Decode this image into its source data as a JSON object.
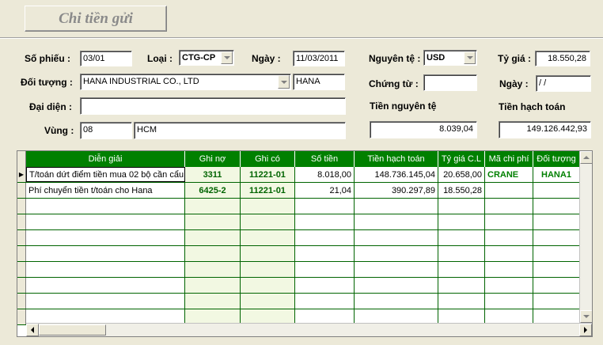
{
  "form": {
    "title": "Chi tiền gửi",
    "so_phieu_label": "Số phiếu :",
    "so_phieu_value": "03/01",
    "loai_label": "Loại :",
    "loai_value": "CTG-CP",
    "ngay_label": "Ngày :",
    "ngay_value": "11/03/2011",
    "nguyen_te_label": "Nguyên tệ :",
    "nguyen_te_value": "USD",
    "ty_gia_label": "Tỷ giá :",
    "ty_gia_value": "18.550,28",
    "doi_tuong_label": "Đối tượng :",
    "doi_tuong_name": "HANA INDUSTRIAL CO., LTD",
    "doi_tuong_code": "HANA",
    "chung_tu_label": "Chứng từ :",
    "chung_tu_value": "",
    "ngay2_label": "Ngày :",
    "ngay2_value": " / /",
    "dai_dien_label": "Đại diện :",
    "dai_dien_value": "",
    "tien_nguyen_te_label": "Tiền nguyên tệ",
    "tien_nguyen_te_value": "8.039,04",
    "tien_hach_toan_label": "Tiền hạch toán",
    "tien_hach_toan_value": "149.126.442,93",
    "vung_label": "Vùng :",
    "vung_code": "08",
    "vung_name": "HCM"
  },
  "grid": {
    "headers": [
      "Diễn giải",
      "Ghi nợ",
      "Ghi có",
      "Số tiền",
      "Tiền hạch toán",
      "Tỷ giá C.L",
      "Mã chi phí",
      "Đối tượng"
    ],
    "rows": [
      {
        "selector": "▶",
        "dien_giai": "T/toán dứt điểm tiền mua 02 bộ cần cẩu",
        "ghi_no": "3311",
        "ghi_co": "11221-01",
        "so_tien": "8.018,00",
        "tien_hach_toan": "148.736.145,04",
        "ty_gia_cl": "20.658,00",
        "ma_chi_phi": "CRANE",
        "doi_tuong": "HANA1"
      },
      {
        "selector": "",
        "dien_giai": "Phí chuyển tiền t/toán cho Hana",
        "ghi_no": "6425-2",
        "ghi_co": "11221-01",
        "so_tien": "21,04",
        "tien_hach_toan": "390.297,89",
        "ty_gia_cl": "18.550,28",
        "ma_chi_phi": "",
        "doi_tuong": ""
      }
    ],
    "empty_rows": 8
  },
  "colors": {
    "background": "#ECE9D8",
    "header_green": "#008000",
    "grid_line": "#006400"
  }
}
